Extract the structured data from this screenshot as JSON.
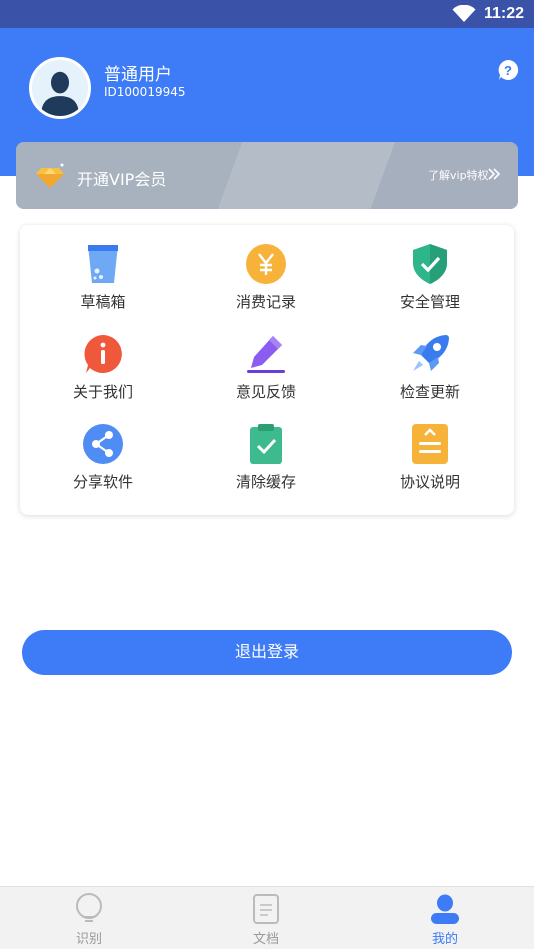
{
  "status_bar": {
    "time": "11:22"
  },
  "profile": {
    "name": "普通用户",
    "id": "ID100019945"
  },
  "vip": {
    "label": "开通VIP会员",
    "more": "了解vip特权"
  },
  "menu": [
    {
      "label": "草稿箱",
      "icon": "drafts-cup-icon"
    },
    {
      "label": "消费记录",
      "icon": "yuan-coin-icon"
    },
    {
      "label": "安全管理",
      "icon": "shield-check-icon"
    },
    {
      "label": "关于我们",
      "icon": "info-icon"
    },
    {
      "label": "意见反馈",
      "icon": "pen-icon"
    },
    {
      "label": "检查更新",
      "icon": "rocket-icon"
    },
    {
      "label": "分享软件",
      "icon": "share-icon"
    },
    {
      "label": "清除缓存",
      "icon": "clipboard-check-icon"
    },
    {
      "label": "协议说明",
      "icon": "document-icon"
    }
  ],
  "logout_label": "退出登录",
  "tabs": [
    {
      "label": "识别",
      "icon": "lightbulb-icon"
    },
    {
      "label": "文档",
      "icon": "document-icon"
    },
    {
      "label": "我的",
      "icon": "user-icon",
      "active": true
    }
  ],
  "colors": {
    "primary": "#3d7bf7",
    "status_bar": "#3a52a8"
  }
}
